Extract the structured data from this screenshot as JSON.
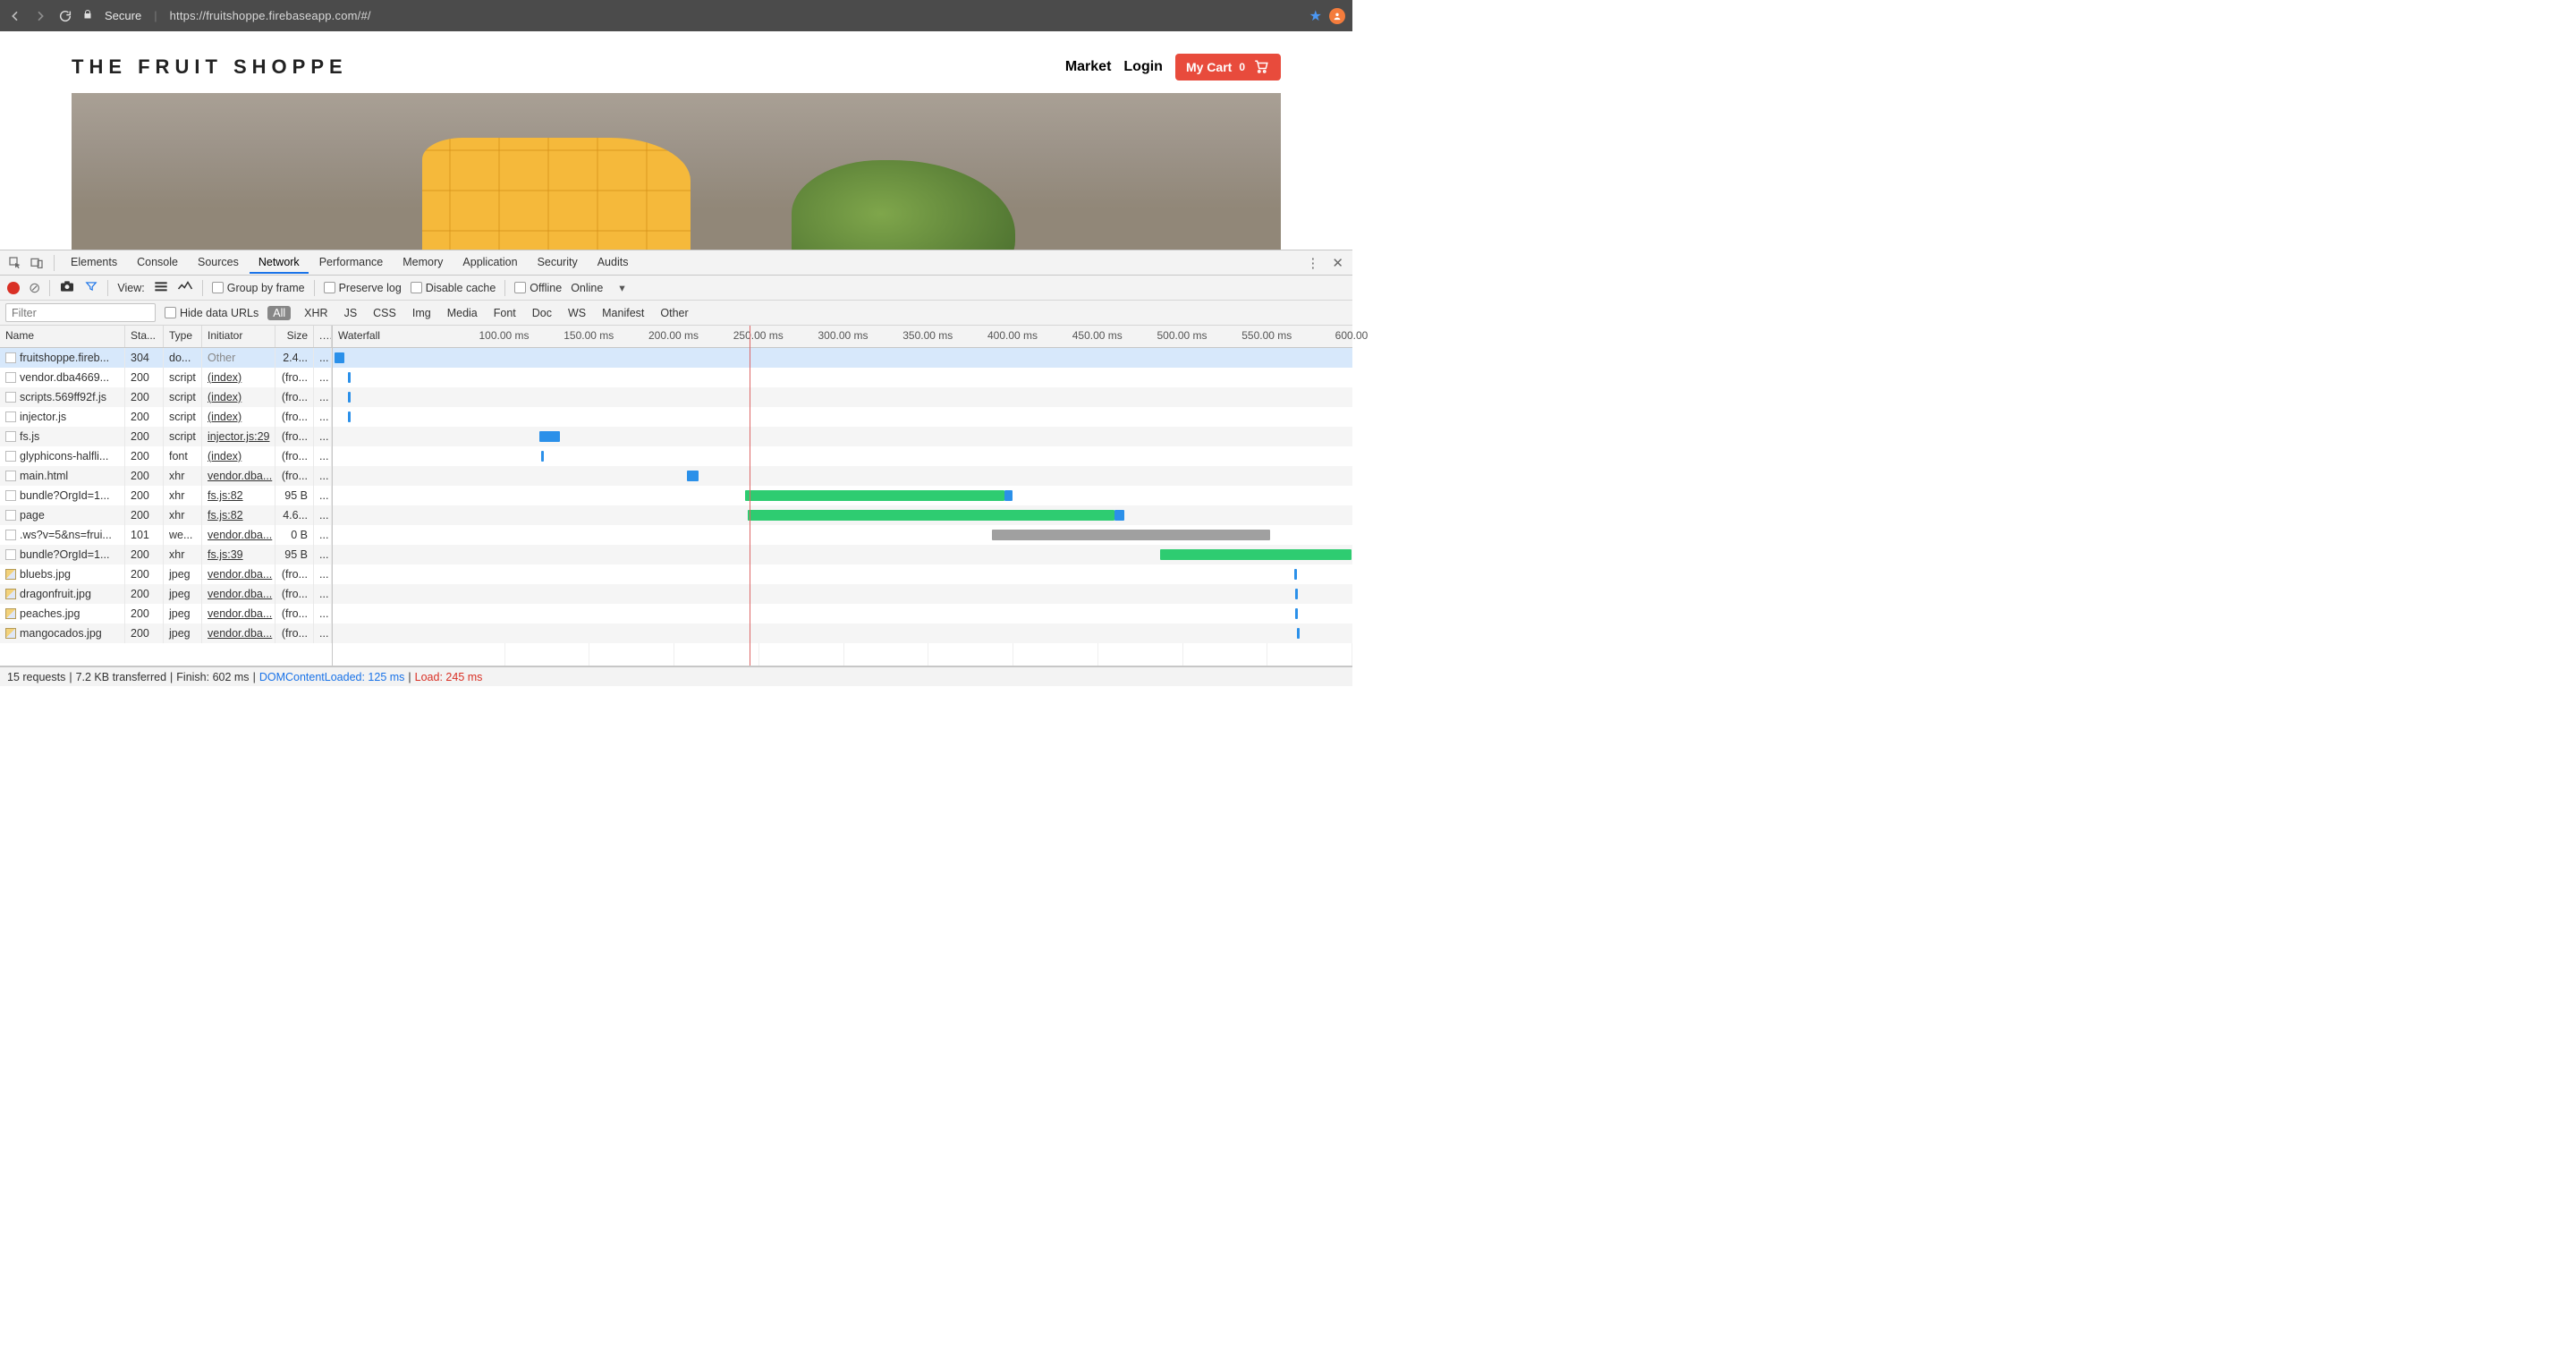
{
  "browser": {
    "secure_label": "Secure",
    "url": "https://fruitshoppe.firebaseapp.com/#/"
  },
  "site": {
    "brand": "THE FRUIT SHOPPE",
    "nav_market": "Market",
    "nav_login": "Login",
    "cart_label": "My Cart",
    "cart_count": "0"
  },
  "devtools": {
    "tabs": [
      "Elements",
      "Console",
      "Sources",
      "Network",
      "Performance",
      "Memory",
      "Application",
      "Security",
      "Audits"
    ],
    "active_tab_index": 3
  },
  "toolbar": {
    "view_label": "View:",
    "group_by_frame": "Group by frame",
    "preserve_log": "Preserve log",
    "disable_cache": "Disable cache",
    "offline": "Offline",
    "online": "Online"
  },
  "filterbar": {
    "filter_placeholder": "Filter",
    "hide_data_urls": "Hide data URLs",
    "types": [
      "All",
      "XHR",
      "JS",
      "CSS",
      "Img",
      "Media",
      "Font",
      "Doc",
      "WS",
      "Manifest",
      "Other"
    ],
    "active_type_index": 0
  },
  "columns": {
    "name": "Name",
    "status": "Sta...",
    "type": "Type",
    "initiator": "Initiator",
    "size": "Size",
    "dash": "...",
    "waterfall": "Waterfall"
  },
  "waterfall": {
    "max_ms": 600,
    "ticks": [
      "100.00 ms",
      "150.00 ms",
      "200.00 ms",
      "250.00 ms",
      "300.00 ms",
      "350.00 ms",
      "400.00 ms",
      "450.00 ms",
      "500.00 ms",
      "550.00 ms",
      "600.00"
    ],
    "marker_ms": 245
  },
  "requests": [
    {
      "name": "fruitshoppe.fireb...",
      "status": "304",
      "type": "do...",
      "initiator": "Other",
      "initiator_plain": true,
      "size": "2.4...",
      "icon": "doc",
      "selected": true,
      "bars": [
        {
          "kind": "blue",
          "start": 0,
          "end": 6
        }
      ]
    },
    {
      "name": "vendor.dba4669...",
      "status": "200",
      "type": "script",
      "initiator": "(index)",
      "size": "(fro...",
      "icon": "doc",
      "bars": [
        {
          "kind": "sliver",
          "start": 8
        }
      ]
    },
    {
      "name": "scripts.569ff92f.js",
      "status": "200",
      "type": "script",
      "initiator": "(index)",
      "size": "(fro...",
      "icon": "doc",
      "bars": [
        {
          "kind": "sliver",
          "start": 8
        }
      ]
    },
    {
      "name": "injector.js",
      "status": "200",
      "type": "script",
      "initiator": "(index)",
      "size": "(fro...",
      "icon": "doc",
      "bars": [
        {
          "kind": "sliver",
          "start": 8
        }
      ]
    },
    {
      "name": "fs.js",
      "status": "200",
      "type": "script",
      "initiator": "injector.js:29",
      "size": "(fro...",
      "icon": "doc",
      "bars": [
        {
          "kind": "blue",
          "start": 121,
          "end": 133
        }
      ]
    },
    {
      "name": "glyphicons-halfli...",
      "status": "200",
      "type": "font",
      "initiator": "(index)",
      "size": "(fro...",
      "icon": "doc",
      "bars": [
        {
          "kind": "sliver",
          "start": 122
        }
      ]
    },
    {
      "name": "main.html",
      "status": "200",
      "type": "xhr",
      "initiator": "vendor.dba...",
      "size": "(fro...",
      "icon": "doc",
      "bars": [
        {
          "kind": "blue",
          "start": 208,
          "end": 215
        }
      ]
    },
    {
      "name": "bundle?OrgId=1...",
      "status": "200",
      "type": "xhr",
      "initiator": "fs.js:82",
      "size": "95 B",
      "icon": "doc",
      "bars": [
        {
          "kind": "green",
          "start": 242,
          "end": 395
        },
        {
          "kind": "blue",
          "start": 395,
          "end": 400
        }
      ]
    },
    {
      "name": "page",
      "status": "200",
      "type": "xhr",
      "initiator": "fs.js:82",
      "size": "4.6...",
      "icon": "doc",
      "bars": [
        {
          "kind": "green",
          "start": 244,
          "end": 460
        },
        {
          "kind": "blue",
          "start": 460,
          "end": 466
        }
      ]
    },
    {
      "name": ".ws?v=5&ns=frui...",
      "status": "101",
      "type": "we...",
      "initiator": "vendor.dba...",
      "size": "0 B",
      "icon": "doc",
      "bars": [
        {
          "kind": "grey",
          "start": 388,
          "end": 552
        }
      ]
    },
    {
      "name": "bundle?OrgId=1...",
      "status": "200",
      "type": "xhr",
      "initiator": "fs.js:39",
      "size": "95 B",
      "icon": "doc",
      "bars": [
        {
          "kind": "green",
          "start": 487,
          "end": 600
        }
      ]
    },
    {
      "name": "bluebs.jpg",
      "status": "200",
      "type": "jpeg",
      "initiator": "vendor.dba...",
      "size": "(fro...",
      "icon": "img",
      "bars": [
        {
          "kind": "sliver",
          "start": 566
        }
      ]
    },
    {
      "name": "dragonfruit.jpg",
      "status": "200",
      "type": "jpeg",
      "initiator": "vendor.dba...",
      "size": "(fro...",
      "icon": "img",
      "bars": [
        {
          "kind": "sliver",
          "start": 567
        }
      ]
    },
    {
      "name": "peaches.jpg",
      "status": "200",
      "type": "jpeg",
      "initiator": "vendor.dba...",
      "size": "(fro...",
      "icon": "img",
      "bars": [
        {
          "kind": "sliver",
          "start": 567
        }
      ]
    },
    {
      "name": "mangocados.jpg",
      "status": "200",
      "type": "jpeg",
      "initiator": "vendor.dba...",
      "size": "(fro...",
      "icon": "img",
      "bars": [
        {
          "kind": "sliver",
          "start": 568
        }
      ]
    }
  ],
  "status": {
    "requests": "15 requests",
    "transferred": "7.2 KB transferred",
    "finish": "Finish: 602 ms",
    "dcl": "DOMContentLoaded: 125 ms",
    "load": "Load: 245 ms",
    "sep": " | "
  }
}
